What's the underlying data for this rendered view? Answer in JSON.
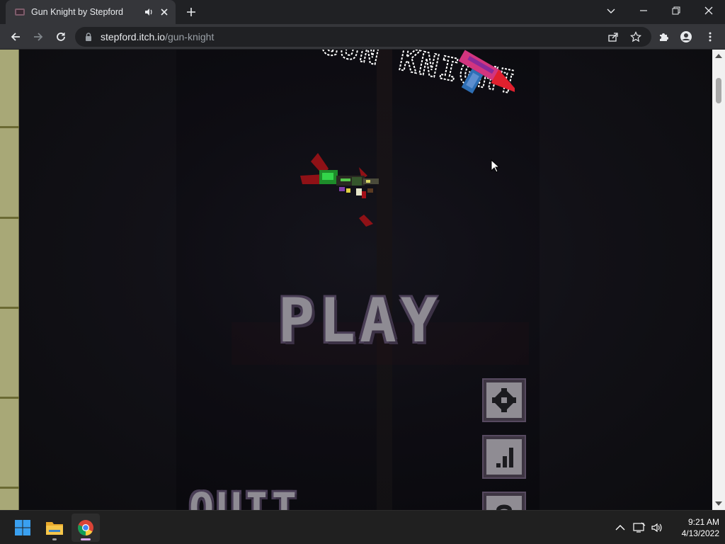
{
  "browser": {
    "tab": {
      "title": "Gun Knight by Stepford"
    },
    "url": {
      "host": "stepford.itch.io",
      "path": "/gun-knight"
    }
  },
  "game": {
    "title_logo": "GUN KNIGHT",
    "play_label": "PLAY",
    "quit_label": "QUIT",
    "side_buttons": [
      "settings-icon",
      "leaderboard-icon",
      "help-icon"
    ]
  },
  "taskbar": {
    "apps": [
      "windows-start-icon",
      "file-explorer-icon",
      "chrome-icon"
    ],
    "time": "9:21 AM",
    "date": "4/13/2022"
  },
  "colors": {
    "chrome_dark": "#202124",
    "chrome_tab": "#35363a",
    "game_bg": "#0b0b0f",
    "button_gray": "#8f8c93",
    "side_strip": "#a8a877"
  }
}
